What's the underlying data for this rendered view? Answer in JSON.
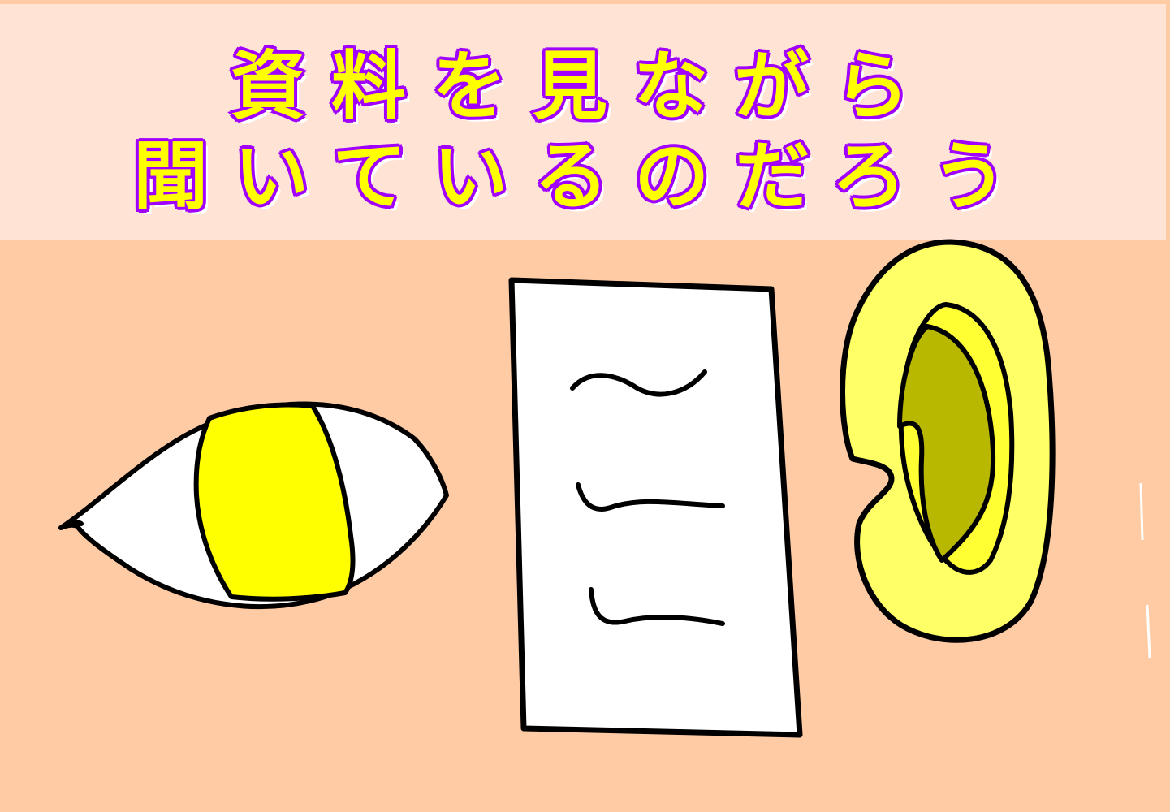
{
  "title": {
    "line1": "資料を見ながら",
    "line2": "聞いているのだろう"
  },
  "colors": {
    "background": "#ffcba4",
    "title_band": "#ffe4d6",
    "title_fill": "#ffff00",
    "title_outline": "#a100ff",
    "iris": "#ffff00",
    "ear_outer": "#ffff66",
    "ear_inner": "#b8b800",
    "paper": "#ffffff",
    "outline": "#000000"
  },
  "illustration": {
    "icons": [
      "eye-icon",
      "document-icon",
      "ear-icon"
    ]
  }
}
